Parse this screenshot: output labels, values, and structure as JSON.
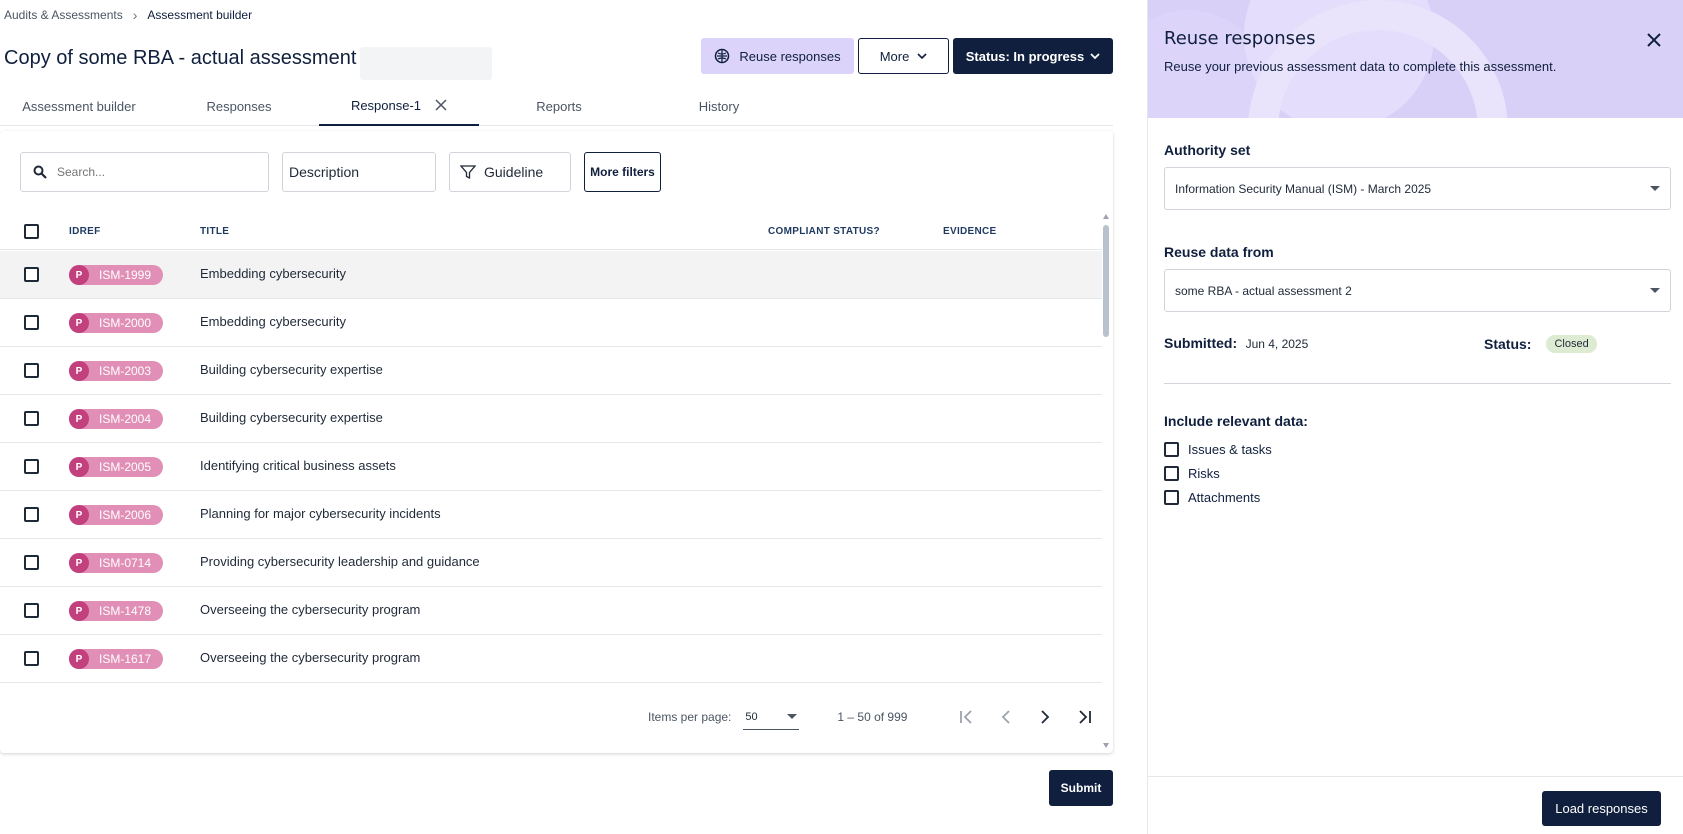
{
  "breadcrumb": {
    "parent": "Audits & Assessments",
    "current": "Assessment builder"
  },
  "page": {
    "title": "Copy of some RBA - actual assessment 2"
  },
  "actions": {
    "reuse_label": "Reuse responses",
    "more_label": "More",
    "status_label": "Status: In progress"
  },
  "tabs": [
    {
      "label": "Assessment builder",
      "active": false
    },
    {
      "label": "Responses",
      "active": false
    },
    {
      "label": "Response-1",
      "active": true
    },
    {
      "label": "Reports",
      "active": false
    },
    {
      "label": "History",
      "active": false
    }
  ],
  "filters": {
    "search_placeholder": "Search...",
    "description_label": "Description",
    "guideline_label": "Guideline",
    "more_filters_label": "More filters"
  },
  "table": {
    "columns": [
      "IDREF",
      "TITLE",
      "COMPLIANT STATUS?",
      "EVIDENCE"
    ],
    "rows": [
      {
        "badge": "P",
        "idref": "ISM-1999",
        "title": "Embedding cybersecurity"
      },
      {
        "badge": "P",
        "idref": "ISM-2000",
        "title": "Embedding cybersecurity"
      },
      {
        "badge": "P",
        "idref": "ISM-2003",
        "title": "Building cybersecurity expertise"
      },
      {
        "badge": "P",
        "idref": "ISM-2004",
        "title": "Building cybersecurity expertise"
      },
      {
        "badge": "P",
        "idref": "ISM-2005",
        "title": "Identifying critical business assets"
      },
      {
        "badge": "P",
        "idref": "ISM-2006",
        "title": "Planning for major cybersecurity incidents"
      },
      {
        "badge": "P",
        "idref": "ISM-0714",
        "title": "Providing cybersecurity leadership and guidance"
      },
      {
        "badge": "P",
        "idref": "ISM-1478",
        "title": "Overseeing the cybersecurity program"
      },
      {
        "badge": "P",
        "idref": "ISM-1617",
        "title": "Overseeing the cybersecurity program"
      }
    ]
  },
  "paginator": {
    "items_per_page_label": "Items per page:",
    "page_size": "50",
    "range": "1 – 50 of 999"
  },
  "submit_label": "Submit",
  "drawer": {
    "title": "Reuse responses",
    "subtitle": "Reuse your previous assessment data to complete this assessment.",
    "authority_label": "Authority set",
    "authority_value": "Information Security Manual (ISM) - March 2025",
    "reuse_from_label": "Reuse data from",
    "reuse_from_value": "some RBA - actual assessment 2",
    "submitted_label": "Submitted:",
    "submitted_value": "Jun 4, 2025",
    "status_label": "Status:",
    "status_value": "Closed",
    "include_label": "Include relevant data:",
    "include_options": [
      "Issues & tasks",
      "Risks",
      "Attachments"
    ],
    "load_label": "Load responses"
  },
  "colors": {
    "primary": "#0f1f3d",
    "reuse_button": "#dcd3fb",
    "badge_bg": "#e18fb6",
    "badge_dot": "#c2407e",
    "drawer_header": "#d9d0f8",
    "closed_badge": "#dcebd2"
  },
  "icons": {
    "reuse": "brain-icon",
    "more": "chevron-down-icon",
    "close": "close-icon",
    "search": "search-icon",
    "filter": "filter-icon"
  }
}
